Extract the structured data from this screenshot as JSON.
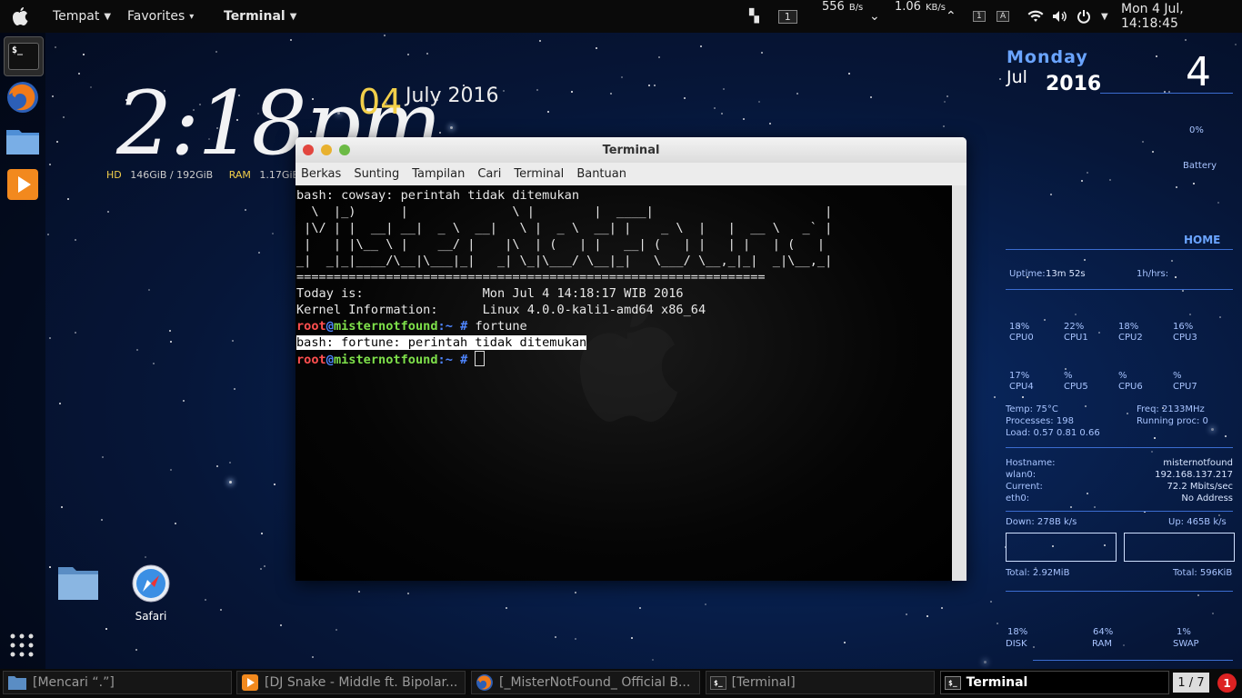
{
  "topbar": {
    "places": "Tempat",
    "favorites": "Favorites",
    "app": "Terminal",
    "workspace": "1",
    "net_down": "556",
    "net_down_unit": "B/s",
    "net_up": "1.06",
    "net_up_unit": "KB/s",
    "kb1": "1",
    "kb2": "A",
    "clock": "Mon  4 Jul, 14:18:45"
  },
  "desktop": {
    "big_time": "2:18pm",
    "day": "04",
    "month_year": "July 2016",
    "hd_label": "HD",
    "hd_value": "146GiB / 192GiB",
    "ram_label": "RAM",
    "ram_value": "1.17GiB"
  },
  "terminal": {
    "title": "Terminal",
    "menu": [
      "Berkas",
      "Sunting",
      "Tampilan",
      "Cari",
      "Terminal",
      "Bantuan"
    ],
    "lines": [
      "bash: cowsay: perintah tidak ditemukan",
      "  \\  |_)      |              \\ |        |  ____|                       |",
      " |\\/ | |  __| __|  _ \\  __|   \\ |  _ \\  __| |    _ \\  |   |  __ \\   _` |",
      " |   | |\\__ \\ |    __/ |    |\\  | (   | |   __| (   | |   | |   | (   |",
      "_|  _|_|____/\\__|\\___|_|   _| \\_|\\___/ \\__|_|   \\___/ \\__,_|_|  _|\\__,_|",
      "",
      "===============================================================",
      "Today is:                Mon Jul 4 14:18:17 WIB 2016",
      "Kernel Information:      Linux 4.0.0-kali1-amd64 x86_64"
    ],
    "prompt_user": "root",
    "prompt_at": "@",
    "prompt_host": "misternotfound",
    "prompt_path": ":~ #",
    "cmd1": " fortune",
    "error_line": "bash: fortune: perintah tidak ditemukan"
  },
  "desktop_icons": [
    {
      "label": ""
    },
    {
      "label": "Safari"
    }
  ],
  "widget": {
    "weekday": "Monday",
    "month": "Jul",
    "year": "2016",
    "daynum": "4",
    "battery_pct": "0%",
    "battery_label": "Battery",
    "home": "HOME",
    "uptime_label": "Uptime:",
    "uptime_value": "13m 52s",
    "uptime_extra": "1h/hrs:",
    "cpus": [
      {
        "pct": "18%",
        "name": "CPU0"
      },
      {
        "pct": "22%",
        "name": "CPU1"
      },
      {
        "pct": "18%",
        "name": "CPU2"
      },
      {
        "pct": "16%",
        "name": "CPU3"
      },
      {
        "pct": "17%",
        "name": "CPU4"
      },
      {
        "pct": "%",
        "name": "CPU5"
      },
      {
        "pct": "%",
        "name": "CPU6"
      },
      {
        "pct": "%",
        "name": "CPU7"
      }
    ],
    "temp": "Temp: 75°C",
    "freq": "Freq: 2133MHz",
    "processes": "Processes: 198",
    "running": "Running proc:  0",
    "load": "Load: 0.57 0.81 0.66",
    "hostname_label": "Hostname:",
    "hostname": "misternotfound",
    "wlan_label": "wlan0:",
    "wlan_ip": "192.168.137.217",
    "current_label": "Current:",
    "current": "72.2  Mbits/sec",
    "eth_label": "eth0:",
    "eth": "No Address",
    "down_label": "Down: 278B   k/s",
    "up_label": "Up: 465B   k/s",
    "total_down": "Total: 2.92MiB",
    "total_up": "Total: 596KiB",
    "disk_pct": "18%",
    "disk_label": "DISK",
    "ram_pct": "64%",
    "ram_label": "RAM",
    "swap_pct": "1%",
    "swap_label": "SWAP"
  },
  "taskbar": {
    "tasks": [
      "[Mencari “.”]",
      "[DJ Snake - Middle ft. Bipolar...",
      "[_MisterNotFound_ Official B...",
      "[Terminal]",
      "Terminal"
    ],
    "workspace": "1 / 7",
    "notifications": "1"
  }
}
